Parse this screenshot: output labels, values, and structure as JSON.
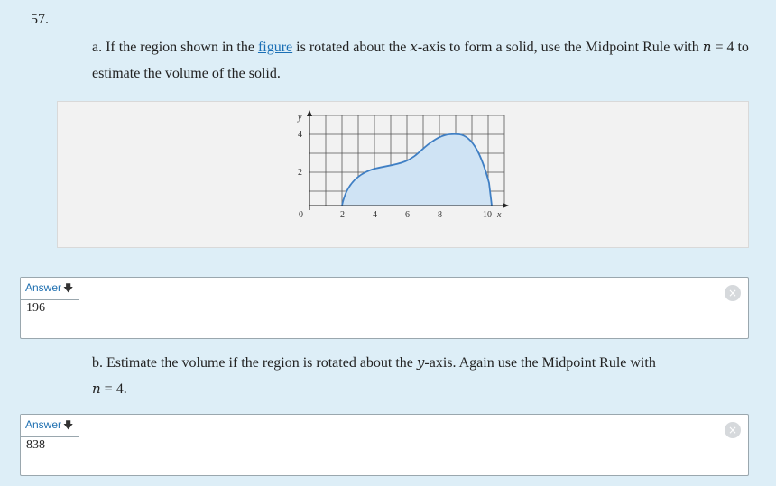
{
  "problem": {
    "number": "57.",
    "part_a": {
      "prefix": "a. If the region shown in the ",
      "link": "figure",
      "middle": " is rotated about the ",
      "var_x": "x",
      "middle2": "-axis to form a solid, use the Midpoint Rule with ",
      "var_n": "n",
      "eq": " = 4 to estimate the volume of the solid."
    },
    "part_b": {
      "prefix": "b. Estimate the volume if the region is rotated about the ",
      "var_y": "y",
      "suffix": "-axis. Again use the Midpoint Rule with",
      "var_n": "n",
      "eq": " = 4."
    }
  },
  "figure": {
    "y_axis_label": "y",
    "x_axis_label": "x",
    "y_ticks": [
      "4",
      "2",
      "0"
    ],
    "x_ticks": [
      "2",
      "4",
      "6",
      "8",
      "10"
    ],
    "fill_color": "#cfe3f4",
    "curve_color": "#3f7fc4"
  },
  "answers": [
    {
      "label": "Answer",
      "arrow": "🡇",
      "value": "196"
    },
    {
      "label": "Answer",
      "arrow": "🡇",
      "value": "838"
    }
  ],
  "clear_icon": "×"
}
